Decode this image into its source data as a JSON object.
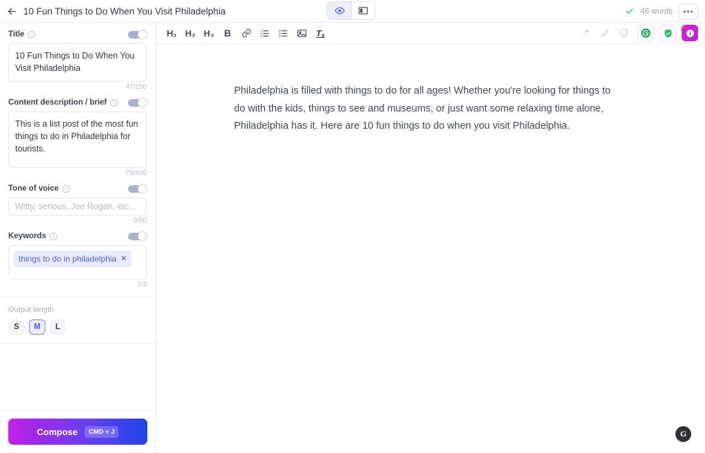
{
  "topbar": {
    "back_icon": "arrow-left-icon",
    "doc_title": "10 Fun Things to Do When You Visit Philadelphia",
    "view_toggle": [
      {
        "id": "preview",
        "icon": "eye-icon",
        "active": true
      },
      {
        "id": "split",
        "icon": "split-pane-icon",
        "active": false
      }
    ],
    "saved_icon": "checkmark-icon",
    "word_count": "46 words",
    "more_label": "•••"
  },
  "sidebar": {
    "fields": [
      {
        "label": "Title",
        "info": "i",
        "toggle_on": true,
        "value": "10 Fun Things to Do When You Visit Philadelphia",
        "placeholder": "",
        "counter": "47/150"
      },
      {
        "label": "Content description / brief",
        "info": "i",
        "toggle_on": true,
        "value": "This is a list post of the most fun things to do in Philadelphia for tourists.",
        "placeholder": "",
        "counter": "78/600"
      },
      {
        "label": "Tone of voice",
        "info": "i",
        "toggle_on": true,
        "value": "",
        "placeholder": "Witty, serious, Joe Rogan, etc...",
        "counter": "0/60"
      },
      {
        "label": "Keywords",
        "info": "i",
        "toggle_on": true,
        "value": "",
        "placeholder": "",
        "counter": "1/3"
      }
    ],
    "keyword_chips": [
      {
        "text": "things to do in philadelphia",
        "remove": "✕"
      }
    ],
    "output": {
      "label": "Output length",
      "options": [
        {
          "label": "S",
          "selected": false
        },
        {
          "label": "M",
          "selected": true
        },
        {
          "label": "L",
          "selected": false
        }
      ]
    },
    "compose": {
      "label": "Compose",
      "shortcut": "CMD + J"
    }
  },
  "editor": {
    "toolbar": [
      {
        "name": "heading-1-button",
        "glyph": "H₁",
        "dim": false
      },
      {
        "name": "heading-2-button",
        "glyph": "H₂",
        "dim": false
      },
      {
        "name": "heading-3-button",
        "glyph": "H₃",
        "dim": false
      },
      {
        "name": "bold-button",
        "glyph": "B",
        "dim": false
      },
      {
        "name": "link-button",
        "glyph": "🔗",
        "dim": false
      },
      {
        "name": "ordered-list-button",
        "glyph": "",
        "dim": false
      },
      {
        "name": "bullet-list-button",
        "glyph": "",
        "dim": false
      },
      {
        "name": "image-button",
        "glyph": "",
        "dim": false
      },
      {
        "name": "clear-format-button",
        "glyph": "Tₓ",
        "dim": false
      }
    ],
    "toolbar_right": [
      {
        "name": "sparkle-icon",
        "dim": true
      },
      {
        "name": "pencil-icon",
        "dim": true
      },
      {
        "name": "emoji-icon",
        "dim": true
      }
    ],
    "extensions": [
      {
        "name": "grammarly-button",
        "letter": "G",
        "color": "#14b05a"
      },
      {
        "name": "shield-check-button",
        "color": "#21c063"
      },
      {
        "name": "assistant-button",
        "color": "#c41fd6"
      }
    ],
    "document_text": "Philadelphia is filled with things to do for all ages! Whether you're looking for things to do with the kids, things to see and museums, or just want some relaxing time alone, Philadelphia has it. Here are 10 fun things to do when you visit Philadelphia.",
    "floating_badge": "G"
  },
  "colors": {
    "accent_purple": "#4c5df5",
    "chip_bg": "#e9ecfd",
    "toggle_track": "#a9b2cc",
    "compose_start": "#c423e8",
    "compose_end": "#2244e8",
    "green": "#37c07a"
  }
}
